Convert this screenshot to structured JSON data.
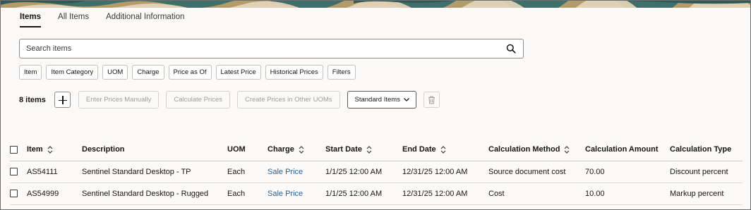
{
  "colors": {
    "accent_link": "#2a6291",
    "banner": "#3e6f6b"
  },
  "tabs": [
    {
      "label": "Items",
      "active": true
    },
    {
      "label": "All Items",
      "active": false
    },
    {
      "label": "Additional Information",
      "active": false
    }
  ],
  "search": {
    "placeholder": "Search items",
    "value": ""
  },
  "filter_chips": [
    "Item",
    "Item Category",
    "UOM",
    "Charge",
    "Price as Of",
    "Latest Price",
    "Historical Prices",
    "Filters"
  ],
  "toolbar": {
    "count_label": "8 items",
    "enter_prices_label": "Enter Prices Manually",
    "calculate_prices_label": "Calculate Prices",
    "create_prices_label": "Create Prices in Other UOMs",
    "view_select_label": "Standard Items"
  },
  "table": {
    "columns": [
      "Item",
      "Description",
      "UOM",
      "Charge",
      "Start Date",
      "End Date",
      "Calculation Method",
      "Calculation Amount",
      "Calculation Type"
    ],
    "rows": [
      [
        "AS54111",
        "Sentinel Standard Desktop - TP",
        "Each",
        "Sale Price",
        "1/1/25 12:00 AM",
        "12/31/25 12:00 AM",
        "Source document cost",
        "70.00",
        "Discount percent"
      ],
      [
        "AS54999",
        "Sentinel Standard Desktop - Rugged",
        "Each",
        "Sale Price",
        "1/1/25 12:00 AM",
        "12/31/25 12:00 AM",
        "Cost",
        "10.00",
        "Markup percent"
      ]
    ]
  }
}
